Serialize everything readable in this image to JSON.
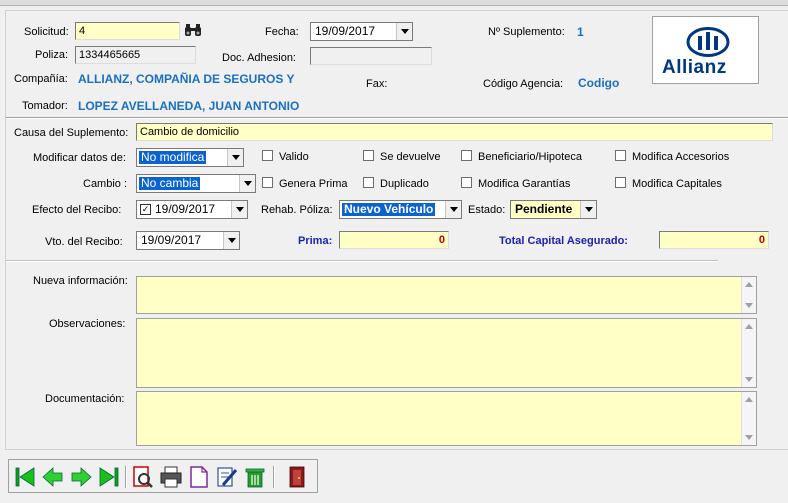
{
  "header": {
    "solicitud_label": "Solicitud:",
    "solicitud_value": "4",
    "fecha_label": "Fecha:",
    "fecha_value": "19/09/2017",
    "suplemento_label": "Nº Suplemento:",
    "suplemento_value": "1",
    "poliza_label": "Poliza:",
    "poliza_value": "1334465665",
    "adhesion_label": "Doc. Adhesion:",
    "adhesion_value": "",
    "compania_label": "Compañía:",
    "compania_value": "ALLIANZ, COMPAÑIA DE SEGUROS Y",
    "fax_label": "Fax:",
    "agencia_label": "Código Agencia:",
    "agencia_value": "Codigo",
    "tomador_label": "Tomador:",
    "tomador_value": "LOPEZ AVELLANEDA, JUAN ANTONIO",
    "logo_text": "Allianz"
  },
  "form": {
    "causa_label": "Causa del Suplemento:",
    "causa_value": "Cambio de domicilio",
    "modificar_label": "Modificar datos de:",
    "modificar_value": "No modifica",
    "cambio_label": "Cambio :",
    "cambio_value": "No cambia",
    "chk_valido": "Valido",
    "chk_se_devuelve": "Se devuelve",
    "chk_beneficiario": "Beneficiario/Hipoteca",
    "chk_accesorios": "Modifica Accesorios",
    "chk_genera_prima": "Genera Prima",
    "chk_duplicado": "Duplicado",
    "chk_garantias": "Modifica Garantías",
    "chk_capitales": "Modifica Capitales",
    "efecto_label": "Efecto del Recibo:",
    "efecto_value": "19/09/2017",
    "rehab_label": "Rehab. Póliza:",
    "rehab_value": "Nuevo Vehículo",
    "estado_label": "Estado:",
    "estado_value": "Pendiente",
    "vto_label": "Vto. del Recibo:",
    "vto_value": "19/09/2017",
    "prima_label": "Prima:",
    "prima_value": "0",
    "capital_label": "Total Capital Asegurado:",
    "capital_value": "0"
  },
  "notes": {
    "nueva_label": "Nueva información:",
    "observaciones_label": "Observaciones:",
    "documentacion_label": "Documentación:"
  },
  "colors": {
    "field_yellow": "#ffffc6",
    "label_blue": "#1a6fc4",
    "label_navy": "#1a22b5",
    "value_red": "#c00000",
    "selection_blue": "#0a63d0",
    "allianz_blue": "#003781"
  },
  "toolbar_icons": [
    "first-record-icon",
    "prev-record-icon",
    "next-record-icon",
    "last-record-icon",
    "search-icon",
    "print-icon",
    "new-document-icon",
    "edit-icon",
    "delete-icon",
    "exit-icon"
  ]
}
